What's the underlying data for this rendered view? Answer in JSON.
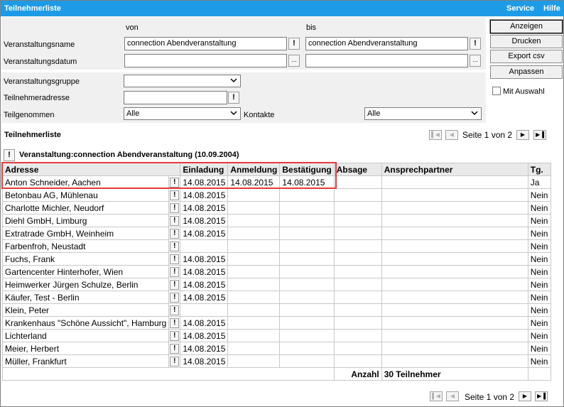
{
  "window": {
    "title": "Teilnehmerliste",
    "menu": [
      "Service",
      "Hilfe"
    ]
  },
  "filters": {
    "von_label": "von",
    "bis_label": "bis",
    "veranstaltungsname_label": "Veranstaltungsname",
    "veranstaltungsname_von": "connection Abendveranstaltung",
    "veranstaltungsname_bis": "connection Abendveranstaltung",
    "veranstaltungsdatum_label": "Veranstaltungsdatum",
    "veranstaltungsdatum_von": "",
    "veranstaltungsdatum_bis": "",
    "veranstaltungsgruppe_label": "Veranstaltungsgruppe",
    "veranstaltungsgruppe_value": "",
    "teilnehmeradresse_label": "Teilnehmeradresse",
    "teilnehmeradresse_value": "",
    "teilgenommen_label": "Teilgenommen",
    "teilgenommen_value": "Alle",
    "kontakte_label": "Kontakte",
    "kontakte_value": "Alle",
    "excl": "!",
    "dots": "..."
  },
  "buttons": {
    "anzeigen": "Anzeigen",
    "drucken": "Drucken",
    "export_csv": "Export csv",
    "anpassen": "Anpassen",
    "mit_auswahl": "Mit Auswahl"
  },
  "list": {
    "heading": "Teilnehmerliste",
    "pager_top": "Seite 1 von 2",
    "pager_bottom": "Seite 1 von 2",
    "group_title": "Veranstaltung:connection Abendveranstaltung (10.09.2004)",
    "columns": [
      "Adresse",
      "Einladung",
      "Anmeldung",
      "Bestätigung",
      "Absage",
      "Ansprechpartner",
      "Tg."
    ],
    "rows": [
      {
        "adresse": "Anton Schneider, Aachen",
        "einladung": "14.08.2015",
        "anmeldung": "14.08.2015",
        "bestaetigung": "14.08.2015",
        "absage": "",
        "ansprechpartner": "",
        "tg": "Ja"
      },
      {
        "adresse": "Betonbau AG, Mühlenau",
        "einladung": "14.08.2015",
        "anmeldung": "",
        "bestaetigung": "",
        "absage": "",
        "ansprechpartner": "",
        "tg": "Nein"
      },
      {
        "adresse": "Charlotte Michler, Neudorf",
        "einladung": "14.08.2015",
        "anmeldung": "",
        "bestaetigung": "",
        "absage": "",
        "ansprechpartner": "",
        "tg": "Nein"
      },
      {
        "adresse": "Diehl GmbH, Limburg",
        "einladung": "14.08.2015",
        "anmeldung": "",
        "bestaetigung": "",
        "absage": "",
        "ansprechpartner": "",
        "tg": "Nein"
      },
      {
        "adresse": "Extratrade GmbH, Weinheim",
        "einladung": "14.08.2015",
        "anmeldung": "",
        "bestaetigung": "",
        "absage": "",
        "ansprechpartner": "",
        "tg": "Nein"
      },
      {
        "adresse": "Farbenfroh, Neustadt",
        "einladung": "",
        "anmeldung": "",
        "bestaetigung": "",
        "absage": "",
        "ansprechpartner": "",
        "tg": "Nein"
      },
      {
        "adresse": "Fuchs, Frank",
        "einladung": "14.08.2015",
        "anmeldung": "",
        "bestaetigung": "",
        "absage": "",
        "ansprechpartner": "",
        "tg": "Nein"
      },
      {
        "adresse": "Gartencenter Hinterhofer, Wien",
        "einladung": "14.08.2015",
        "anmeldung": "",
        "bestaetigung": "",
        "absage": "",
        "ansprechpartner": "",
        "tg": "Nein"
      },
      {
        "adresse": "Heimwerker Jürgen Schulze, Berlin",
        "einladung": "14.08.2015",
        "anmeldung": "",
        "bestaetigung": "",
        "absage": "",
        "ansprechpartner": "",
        "tg": "Nein"
      },
      {
        "adresse": "Käufer, Test - Berlin",
        "einladung": "14.08.2015",
        "anmeldung": "",
        "bestaetigung": "",
        "absage": "",
        "ansprechpartner": "",
        "tg": "Nein"
      },
      {
        "adresse": "Klein, Peter",
        "einladung": "",
        "anmeldung": "",
        "bestaetigung": "",
        "absage": "",
        "ansprechpartner": "",
        "tg": "Nein"
      },
      {
        "adresse": "Krankenhaus \"Schöne Aussicht\", Hamburg",
        "einladung": "14.08.2015",
        "anmeldung": "",
        "bestaetigung": "",
        "absage": "",
        "ansprechpartner": "",
        "tg": "Nein"
      },
      {
        "adresse": "Lichterland",
        "einladung": "14.08.2015",
        "anmeldung": "",
        "bestaetigung": "",
        "absage": "",
        "ansprechpartner": "",
        "tg": "Nein"
      },
      {
        "adresse": "Meier, Herbert",
        "einladung": "14.08.2015",
        "anmeldung": "",
        "bestaetigung": "",
        "absage": "",
        "ansprechpartner": "",
        "tg": "Nein"
      },
      {
        "adresse": "Müller, Frankfurt",
        "einladung": "14.08.2015",
        "anmeldung": "",
        "bestaetigung": "",
        "absage": "",
        "ansprechpartner": "",
        "tg": "Nein"
      }
    ],
    "anzahl_label": "Anzahl",
    "anzahl_value": "30 Teilnehmer"
  },
  "colors": {
    "titlebar": "#1e9be6",
    "highlight": "#e53a3a"
  },
  "icons": {
    "first": "first-page-icon",
    "prev": "prev-page-icon",
    "next": "next-page-icon",
    "last": "last-page-icon",
    "select": "chevron-down-icon"
  }
}
